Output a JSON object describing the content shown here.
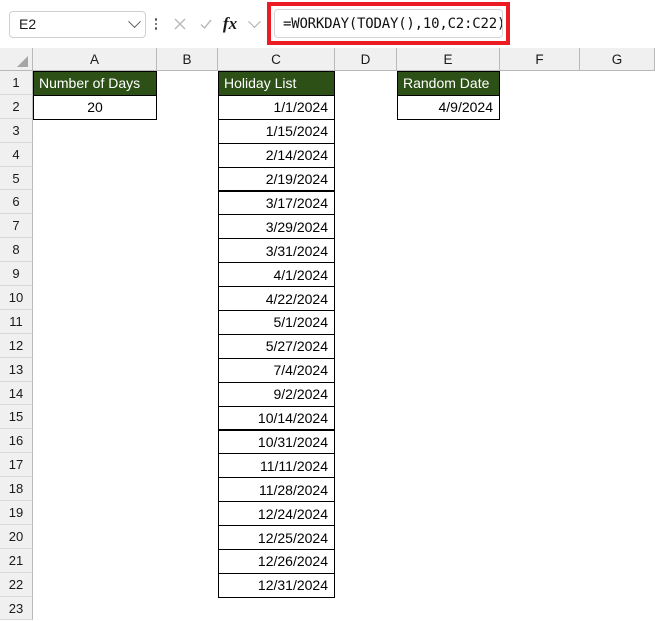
{
  "formula_bar": {
    "name_box_value": "E2",
    "name_box_placeholder": "Name Box",
    "cancel_icon": "close-icon",
    "enter_icon": "check-icon",
    "fx_label": "fx",
    "formula_value": "=WORKDAY(TODAY(),10,C2:C22)",
    "formula_placeholder": "Enter formula",
    "highlight_color": "#ec1c24"
  },
  "grid": {
    "column_headers": [
      "A",
      "B",
      "C",
      "D",
      "E",
      "F",
      "G"
    ],
    "row_headers": [
      "1",
      "2",
      "3",
      "4",
      "5",
      "6",
      "7",
      "8",
      "9",
      "10",
      "11",
      "12",
      "13",
      "14",
      "15",
      "16",
      "17",
      "18",
      "19",
      "20",
      "21",
      "22",
      "23"
    ],
    "header_fill": "#2d5016",
    "header_text_color": "#ffffff",
    "cells": [
      {
        "ref": "A1",
        "col": 0,
        "row": 0,
        "text": "Number of Days",
        "style": "header"
      },
      {
        "ref": "A2",
        "col": 0,
        "row": 1,
        "text": "20",
        "style": "value-center"
      },
      {
        "ref": "C1",
        "col": 2,
        "row": 0,
        "text": "Holiday List",
        "style": "header"
      },
      {
        "ref": "C2",
        "col": 2,
        "row": 1,
        "text": "1/1/2024",
        "style": "value"
      },
      {
        "ref": "C3",
        "col": 2,
        "row": 2,
        "text": "1/15/2024",
        "style": "value"
      },
      {
        "ref": "C4",
        "col": 2,
        "row": 3,
        "text": "2/14/2024",
        "style": "value"
      },
      {
        "ref": "C5",
        "col": 2,
        "row": 4,
        "text": "2/19/2024",
        "style": "value"
      },
      {
        "ref": "C6",
        "col": 2,
        "row": 5,
        "text": "3/17/2024",
        "style": "value"
      },
      {
        "ref": "C7",
        "col": 2,
        "row": 6,
        "text": "3/29/2024",
        "style": "value"
      },
      {
        "ref": "C8",
        "col": 2,
        "row": 7,
        "text": "3/31/2024",
        "style": "value"
      },
      {
        "ref": "C9",
        "col": 2,
        "row": 8,
        "text": "4/1/2024",
        "style": "value"
      },
      {
        "ref": "C10",
        "col": 2,
        "row": 9,
        "text": "4/22/2024",
        "style": "value"
      },
      {
        "ref": "C11",
        "col": 2,
        "row": 10,
        "text": "5/1/2024",
        "style": "value"
      },
      {
        "ref": "C12",
        "col": 2,
        "row": 11,
        "text": "5/27/2024",
        "style": "value"
      },
      {
        "ref": "C13",
        "col": 2,
        "row": 12,
        "text": "7/4/2024",
        "style": "value"
      },
      {
        "ref": "C14",
        "col": 2,
        "row": 13,
        "text": "9/2/2024",
        "style": "value"
      },
      {
        "ref": "C15",
        "col": 2,
        "row": 14,
        "text": "10/14/2024",
        "style": "value"
      },
      {
        "ref": "C16",
        "col": 2,
        "row": 15,
        "text": "10/31/2024",
        "style": "value"
      },
      {
        "ref": "C17",
        "col": 2,
        "row": 16,
        "text": "11/11/2024",
        "style": "value"
      },
      {
        "ref": "C18",
        "col": 2,
        "row": 17,
        "text": "11/28/2024",
        "style": "value"
      },
      {
        "ref": "C19",
        "col": 2,
        "row": 18,
        "text": "12/24/2024",
        "style": "value"
      },
      {
        "ref": "C20",
        "col": 2,
        "row": 19,
        "text": "12/25/2024",
        "style": "value"
      },
      {
        "ref": "C21",
        "col": 2,
        "row": 20,
        "text": "12/26/2024",
        "style": "value"
      },
      {
        "ref": "C22",
        "col": 2,
        "row": 21,
        "text": "12/31/2024",
        "style": "value"
      },
      {
        "ref": "E1",
        "col": 4,
        "row": 0,
        "text": "Random Date",
        "style": "header"
      },
      {
        "ref": "E2",
        "col": 4,
        "row": 1,
        "text": "4/9/2024",
        "style": "value"
      }
    ]
  }
}
